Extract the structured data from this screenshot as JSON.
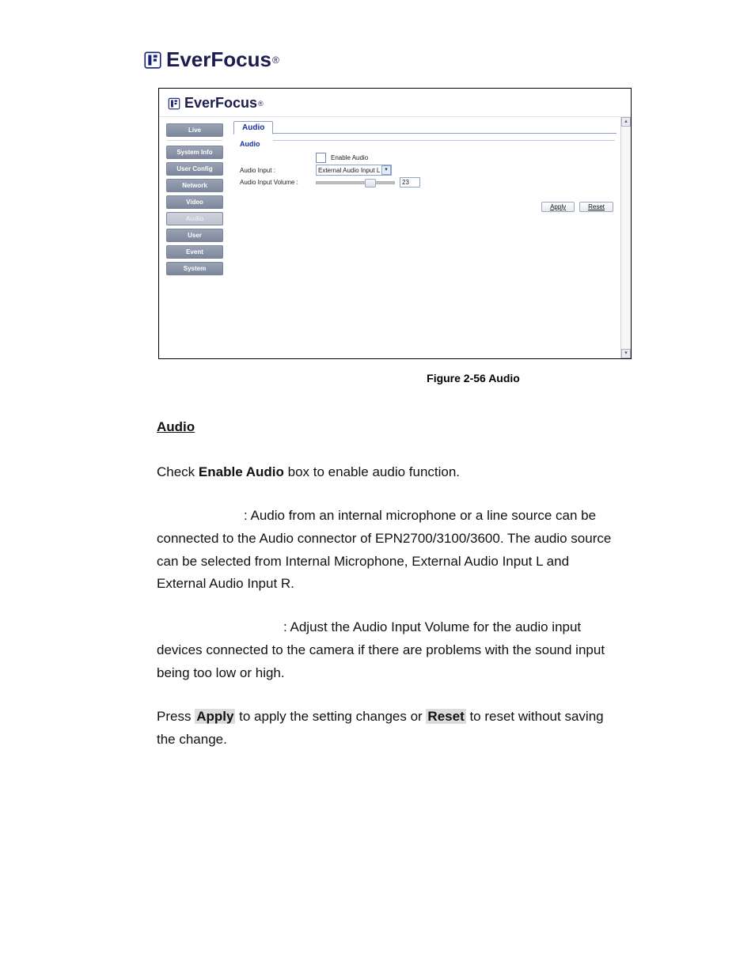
{
  "brand": {
    "name": "EverFocus",
    "reg": "®"
  },
  "screenshot": {
    "sidebar": {
      "live": "Live",
      "items": [
        "System Info",
        "User Config",
        "Network",
        "Video",
        "Audio",
        "User",
        "Event",
        "System"
      ],
      "active_index": 4
    },
    "tab": "Audio",
    "fieldset_legend": "Audio",
    "enable_audio_label": "Enable Audio",
    "audio_input_label": "Audio Input :",
    "audio_input_value": "External Audio Input L",
    "audio_input_volume_label": "Audio Input Volume :",
    "audio_input_volume_value": "23",
    "apply_label": "Apply",
    "reset_label": "Reset"
  },
  "caption": "Figure 2-56 Audio",
  "copy": {
    "heading": "Audio",
    "p1_a": "Check ",
    "p1_b": "Enable Audio",
    "p1_c": " box to enable audio function.",
    "p2": ": Audio from an internal microphone or a line source can be connected to the Audio connector of EPN2700/3100/3600. The audio source can be selected from Internal Microphone, External Audio Input L and External Audio Input R.",
    "p3": ": Adjust the Audio Input Volume for the audio input devices connected to the camera if there are problems with the sound input being too low or high.",
    "p4_a": "Press ",
    "p4_b": "Apply",
    "p4_c": " to apply the setting changes or ",
    "p4_d": "Reset",
    "p4_e": " to reset without saving the change."
  }
}
